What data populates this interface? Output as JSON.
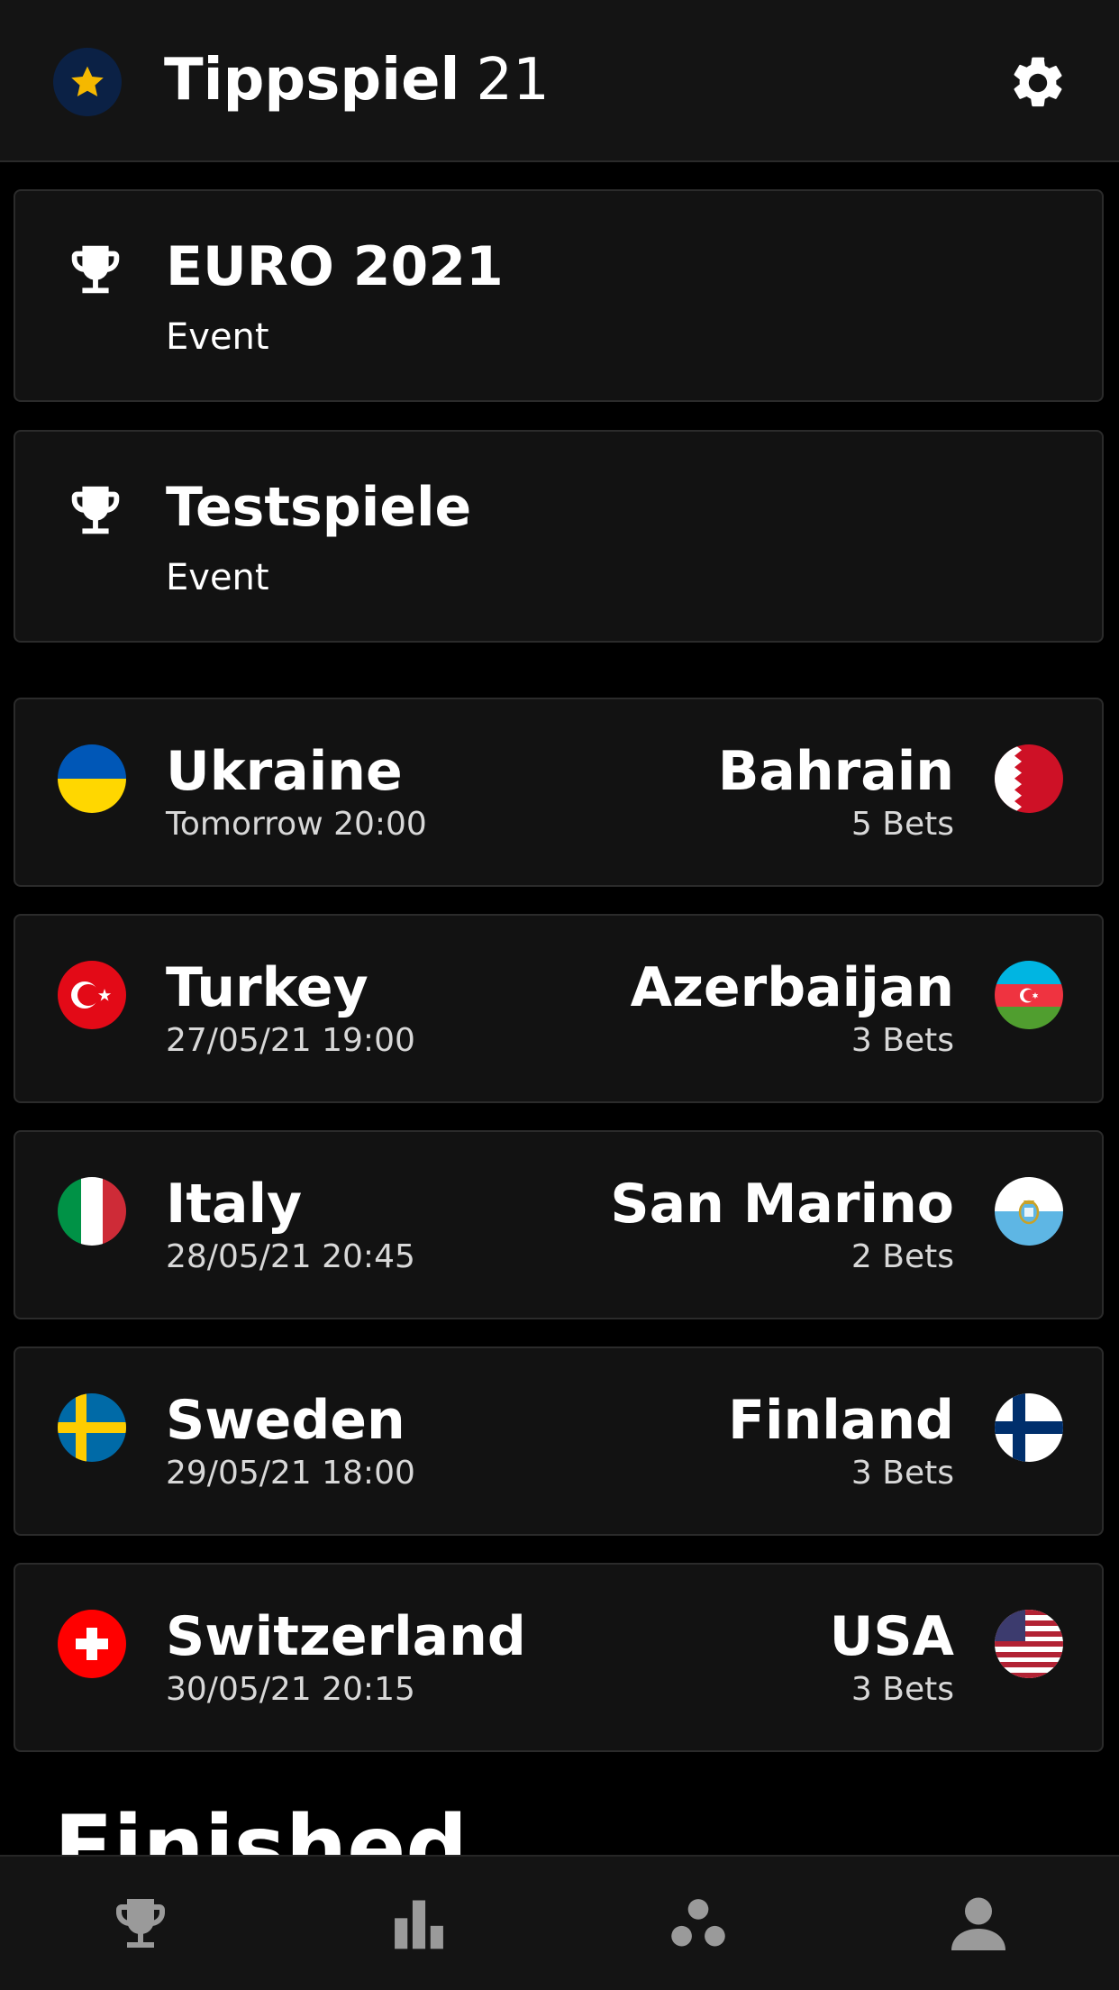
{
  "header": {
    "title_bold": "Tippspiel",
    "title_regular": "21",
    "logo_icon": "star-icon",
    "settings_icon": "gear-icon"
  },
  "events": [
    {
      "title": "EURO 2021",
      "subtitle": "Event",
      "icon": "trophy-icon"
    },
    {
      "title": "Testspiele",
      "subtitle": "Event",
      "icon": "trophy-icon"
    }
  ],
  "matches": [
    {
      "home": "Ukraine",
      "away": "Bahrain",
      "date": "Tomorrow 20:00",
      "bets": "5 Bets"
    },
    {
      "home": "Turkey",
      "away": "Azerbaijan",
      "date": "27/05/21 19:00",
      "bets": "3 Bets"
    },
    {
      "home": "Italy",
      "away": "San Marino",
      "date": "28/05/21 20:45",
      "bets": "2 Bets"
    },
    {
      "home": "Sweden",
      "away": "Finland",
      "date": "29/05/21 18:00",
      "bets": "3 Bets"
    },
    {
      "home": "Switzerland",
      "away": "USA",
      "date": "30/05/21 20:15",
      "bets": "3 Bets"
    }
  ],
  "finished_label": "Finished",
  "bottom_nav": [
    {
      "icon": "trophy-icon"
    },
    {
      "icon": "bar-chart-icon"
    },
    {
      "icon": "group-icon"
    },
    {
      "icon": "person-icon"
    }
  ],
  "colors": {
    "background": "#000000",
    "surface": "#121212",
    "border": "#2b2b2b",
    "accent_star": "#f5b800",
    "nav_icon": "#9a9a9a"
  }
}
